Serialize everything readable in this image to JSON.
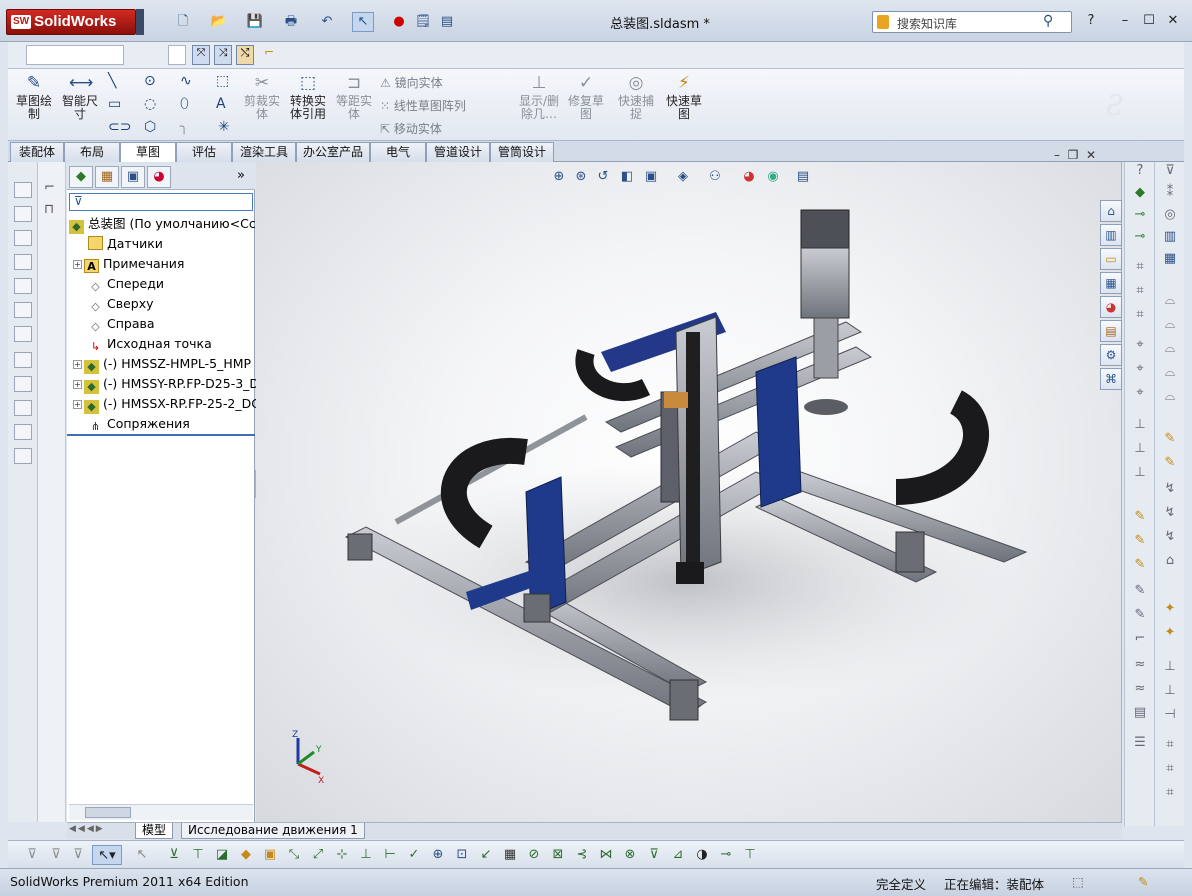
{
  "app": {
    "brand": "SolidWorks",
    "brand_badge": "SW",
    "doc_title": "总装图.sldasm *"
  },
  "search": {
    "placeholder": "搜索知识库"
  },
  "ribbon": {
    "sketch": "草图绘\n制",
    "smart_dim": "智能尺\n寸",
    "trim": "剪裁实\n体",
    "convert": "转换实\n体引用",
    "offset": "等距实\n体",
    "mirror": "镜向实体",
    "linear_pattern": "线性草图阵列",
    "move": "移动实体",
    "show_delete": "显示/删\n除几…",
    "repair": "修复草\n图",
    "quick_snap": "快速捕\n捉",
    "rapid_sketch": "快速草\n图"
  },
  "tabs": [
    "装配体",
    "布局",
    "草图",
    "评估",
    "渲染工具",
    "办公室产品",
    "电气",
    "管道设计",
    "管筒设计"
  ],
  "active_tab": "草图",
  "tree": {
    "root": "总装图  (По умолчанию<Сс",
    "items": [
      {
        "label": "Датчики",
        "icon": "sensor-folder-icon"
      },
      {
        "label": "Примечания",
        "icon": "annotations-icon",
        "expandable": true
      },
      {
        "label": "Спереди",
        "icon": "plane-icon"
      },
      {
        "label": "Сверху",
        "icon": "plane-icon"
      },
      {
        "label": "Справа",
        "icon": "plane-icon"
      },
      {
        "label": "Исходная точка",
        "icon": "origin-icon"
      },
      {
        "label": "(-) HMSSZ-HMPL-5_HMP",
        "icon": "subassembly-icon",
        "expandable": true
      },
      {
        "label": "(-) HMSSY-RP.FP-D25-3_D",
        "icon": "subassembly-icon",
        "expandable": true
      },
      {
        "label": "(-) HMSSX-RP.FP-25-2_DC",
        "icon": "subassembly-icon",
        "expandable": true
      },
      {
        "label": "Сопряжения",
        "icon": "mates-icon"
      }
    ]
  },
  "model_tabs": [
    "模型",
    "Исследование движения 1"
  ],
  "status": {
    "edition": "SolidWorks Premium 2011 x64 Edition",
    "defined": "完全定义",
    "editing": "正在编辑：装配体"
  },
  "triad": {
    "x": "X",
    "y": "Y",
    "z": "Z"
  },
  "colors": {
    "accent": "#2b4f86",
    "brand": "#c01c14",
    "machine_blue": "#1f3a8a",
    "rail_grey": "#8d9097"
  }
}
